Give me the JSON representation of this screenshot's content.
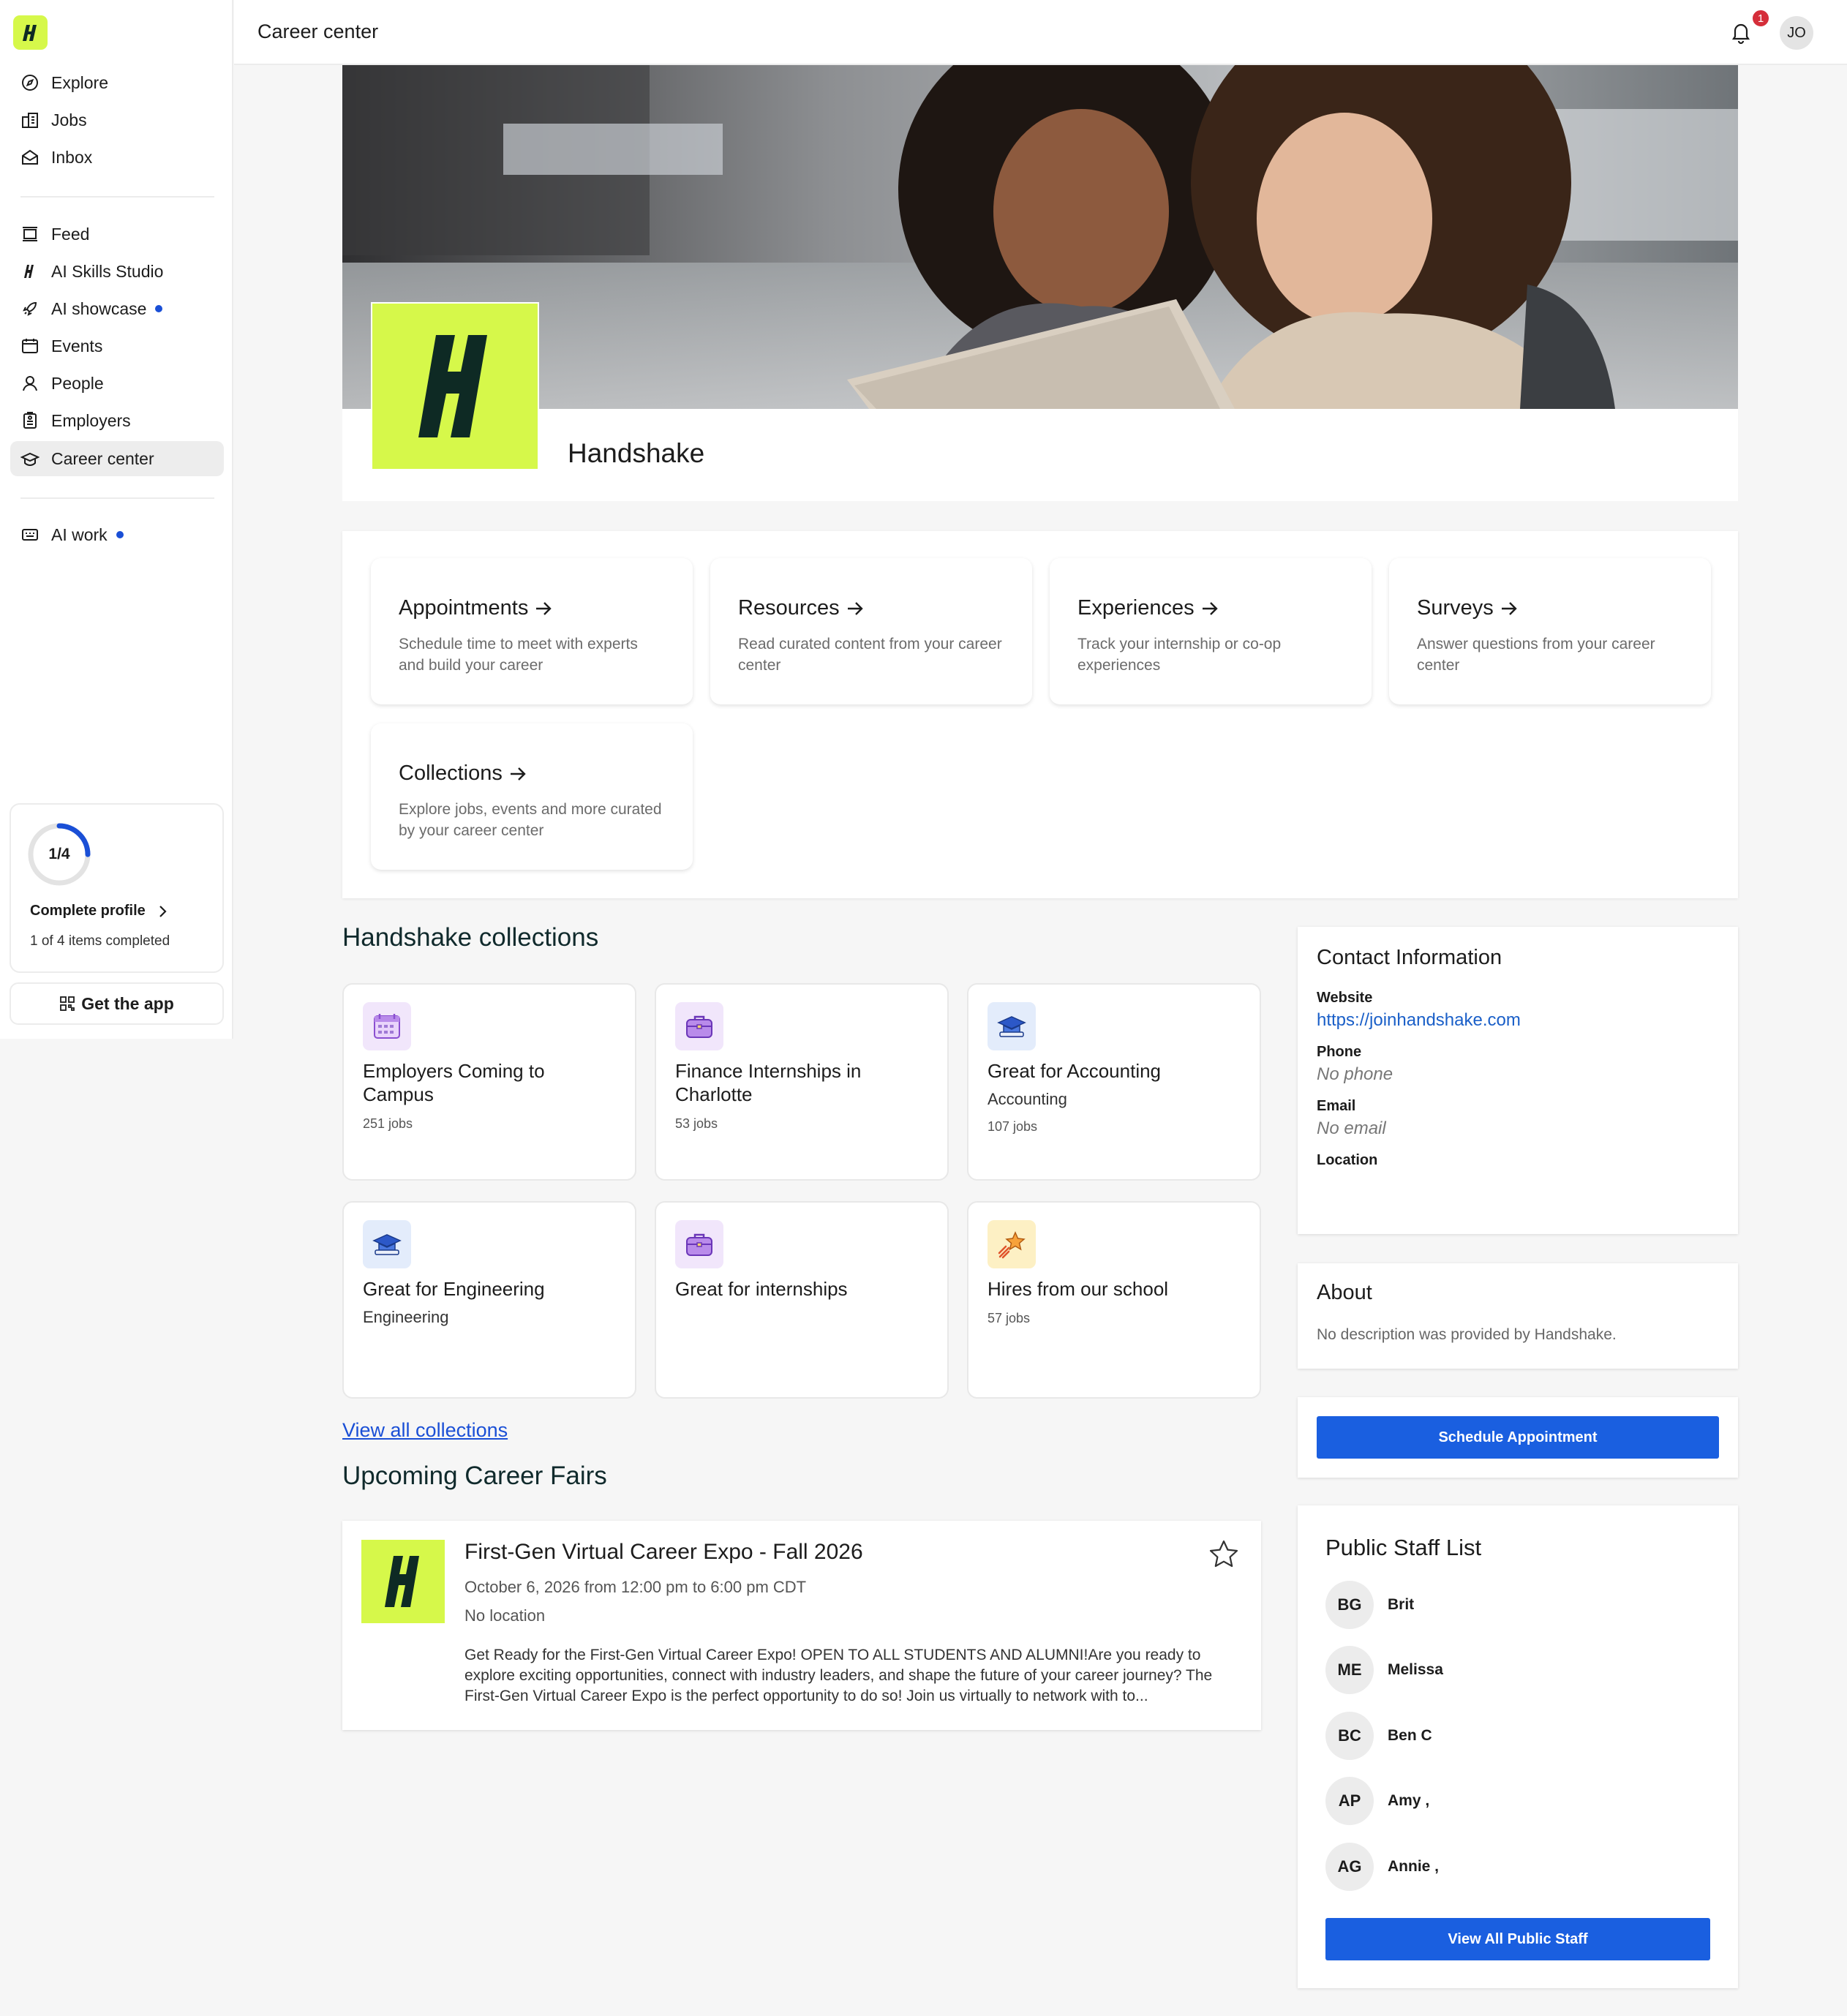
{
  "sidebar": {
    "nav": [
      {
        "label": "Explore",
        "icon": "compass-icon"
      },
      {
        "label": "Jobs",
        "icon": "buildings-icon"
      },
      {
        "label": "Inbox",
        "icon": "inbox-icon"
      },
      {
        "label": "Feed",
        "icon": "feed-icon"
      },
      {
        "label": "AI Skills Studio",
        "icon": "ai-skills-icon"
      },
      {
        "label": "AI showcase",
        "icon": "rocket-icon"
      },
      {
        "label": "Events",
        "icon": "calendar-icon"
      },
      {
        "label": "People",
        "icon": "person-icon"
      },
      {
        "label": "Employers",
        "icon": "employer-badge-icon"
      },
      {
        "label": "Career center",
        "icon": "graduation-cap-icon"
      },
      {
        "label": "AI work",
        "icon": "keyboard-icon"
      }
    ],
    "active": "Career center",
    "progress": {
      "ring_text": "1/4",
      "fraction": 0.25,
      "cta": "Complete profile",
      "status": "1 of 4 items completed"
    },
    "get_app": "Get the app"
  },
  "header": {
    "title": "Career center",
    "notification_count": "1",
    "avatar_initials": "JO"
  },
  "school": {
    "name": "Handshake"
  },
  "tools": [
    {
      "title": "Appointments",
      "desc": "Schedule time to meet with experts and build your career"
    },
    {
      "title": "Resources",
      "desc": "Read curated content from your career center"
    },
    {
      "title": "Experiences",
      "desc": "Track your internship or co-op experiences"
    },
    {
      "title": "Surveys",
      "desc": "Answer questions from your career center"
    },
    {
      "title": "Collections",
      "desc": "Explore jobs, events and more curated by your career center"
    }
  ],
  "collections": {
    "title": "Handshake collections",
    "items": [
      {
        "title": "Employers Coming to Campus",
        "subtitle": "",
        "count": "251 jobs",
        "icon": "calendar-icon",
        "bg": "#f1e6fb"
      },
      {
        "title": "Finance Internships in Charlotte",
        "subtitle": "",
        "count": "53 jobs",
        "icon": "briefcase-icon",
        "bg": "#f1e6fb"
      },
      {
        "title": "Great for Accounting",
        "subtitle": "Accounting",
        "count": "107 jobs",
        "icon": "graduation-cap-icon",
        "bg": "#e3ecfb"
      },
      {
        "title": "Great for Engineering",
        "subtitle": "Engineering",
        "count": "",
        "icon": "graduation-cap-icon",
        "bg": "#e3ecfb"
      },
      {
        "title": "Great for internships",
        "subtitle": "",
        "count": "",
        "icon": "briefcase-icon",
        "bg": "#f1e6fb"
      },
      {
        "title": "Hires from our school",
        "subtitle": "",
        "count": "57 jobs",
        "icon": "shooting-star-icon",
        "bg": "#fdf0c4"
      }
    ],
    "view_all": "View all collections"
  },
  "fairs": {
    "title": "Upcoming Career Fairs",
    "items": [
      {
        "title": "First-Gen Virtual Career Expo - Fall 2026",
        "date": "October 6, 2026 from 12:00 pm to 6:00 pm CDT",
        "location": "No location",
        "description": "Get Ready for the First-Gen Virtual Career Expo! OPEN TO ALL STUDENTS AND ALUMNI!Are you ready to explore exciting opportunities, connect with industry leaders, and shape the future of your career journey? The First-Gen Virtual Career Expo is the perfect opportunity to do so! Join us virtually to network with to..."
      }
    ]
  },
  "contact": {
    "title": "Contact Information",
    "website_label": "Website",
    "website": "https://joinhandshake.com",
    "phone_label": "Phone",
    "phone": "No phone",
    "email_label": "Email",
    "email": "No email",
    "location_label": "Location"
  },
  "about": {
    "title": "About",
    "text": "No description was provided by Handshake."
  },
  "schedule_button": "Schedule Appointment",
  "staff": {
    "title": "Public Staff List",
    "members": [
      {
        "initials": "BG",
        "name": "Brit"
      },
      {
        "initials": "ME",
        "name": "Melissa"
      },
      {
        "initials": "BC",
        "name": "Ben C"
      },
      {
        "initials": "AP",
        "name": "Amy ,"
      },
      {
        "initials": "AG",
        "name": "Annie ,"
      }
    ],
    "view_all": "View All Public Staff"
  },
  "colors": {
    "brand_lime": "#d6f84a",
    "accent_blue": "#1a5fe0",
    "link_blue": "#1a4fd6",
    "badge_red": "#d52e3a"
  }
}
